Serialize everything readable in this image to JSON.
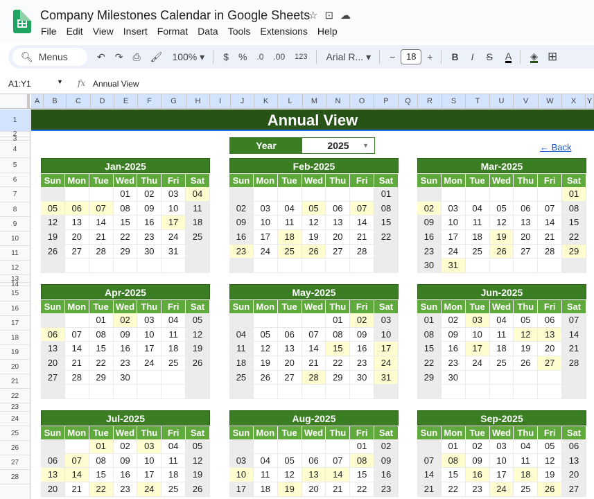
{
  "app": {
    "doc_title": "Company Milestones Calendar in Google Sheets",
    "menus": [
      "File",
      "Edit",
      "View",
      "Insert",
      "Format",
      "Data",
      "Tools",
      "Extensions",
      "Help"
    ]
  },
  "toolbar": {
    "search_label": "Menus",
    "zoom": "100%",
    "currency": "$",
    "percent": "%",
    "dec_decrease": ".0",
    "dec_increase": ".00",
    "number_format": "123",
    "font": "Arial R...",
    "font_size": "18",
    "bold": "B",
    "italic": "I",
    "strike": "S",
    "text_color": "A"
  },
  "formula_bar": {
    "cell_ref": "A1:Y1",
    "content": "Annual View"
  },
  "columns": [
    "A",
    "B",
    "C",
    "D",
    "E",
    "F",
    "G",
    "H",
    "I",
    "J",
    "K",
    "L",
    "M",
    "N",
    "O",
    "P",
    "Q",
    "R",
    "S",
    "T",
    "U",
    "V",
    "W",
    "X",
    "Y"
  ],
  "rows": [
    "1",
    "2",
    "3",
    "4",
    "5",
    "6",
    "7",
    "8",
    "9",
    "10",
    "11",
    "12",
    "13",
    "14",
    "15",
    "16",
    "17",
    "18",
    "19",
    "20",
    "21",
    "22",
    "23",
    "24",
    "25",
    "26",
    "27",
    "28"
  ],
  "sheet": {
    "banner": "Annual View",
    "year_label": "Year",
    "year_value": "2025",
    "back_link": "← Back",
    "day_names": [
      "Sun",
      "Mon",
      "Tue",
      "Wed",
      "Thu",
      "Fri",
      "Sat"
    ]
  },
  "months": [
    {
      "title": "Jan-2025",
      "weeks": [
        [
          "",
          "",
          "",
          "01",
          "02",
          "03",
          "04"
        ],
        [
          "05",
          "06",
          "07",
          "08",
          "09",
          "10",
          "11"
        ],
        [
          "12",
          "13",
          "14",
          "15",
          "16",
          "17",
          "18"
        ],
        [
          "19",
          "20",
          "21",
          "22",
          "23",
          "24",
          "25"
        ],
        [
          "26",
          "27",
          "28",
          "29",
          "30",
          "31",
          ""
        ],
        [
          "",
          "",
          "",
          "",
          "",
          "",
          ""
        ]
      ],
      "highlights": [
        "04",
        "05",
        "06",
        "07",
        "17"
      ]
    },
    {
      "title": "Feb-2025",
      "weeks": [
        [
          "",
          "",
          "",
          "",
          "",
          "",
          "01"
        ],
        [
          "02",
          "03",
          "04",
          "05",
          "06",
          "07",
          "08"
        ],
        [
          "09",
          "10",
          "11",
          "12",
          "13",
          "14",
          "15"
        ],
        [
          "16",
          "17",
          "18",
          "19",
          "20",
          "21",
          "22"
        ],
        [
          "23",
          "24",
          "25",
          "26",
          "27",
          "28",
          ""
        ],
        [
          "",
          "",
          "",
          "",
          "",
          "",
          ""
        ]
      ],
      "highlights": [
        "05",
        "07",
        "18",
        "23",
        "25",
        "26"
      ]
    },
    {
      "title": "Mar-2025",
      "weeks": [
        [
          "",
          "",
          "",
          "",
          "",
          "",
          "01"
        ],
        [
          "02",
          "03",
          "04",
          "05",
          "06",
          "07",
          "08"
        ],
        [
          "09",
          "10",
          "11",
          "12",
          "13",
          "14",
          "15"
        ],
        [
          "16",
          "17",
          "18",
          "19",
          "20",
          "21",
          "22"
        ],
        [
          "23",
          "24",
          "25",
          "26",
          "27",
          "28",
          "29"
        ],
        [
          "30",
          "31",
          "",
          "",
          "",
          "",
          ""
        ]
      ],
      "highlights": [
        "01",
        "02",
        "19",
        "26",
        "29",
        "31"
      ]
    },
    {
      "title": "Apr-2025",
      "weeks": [
        [
          "",
          "",
          "01",
          "02",
          "03",
          "04",
          "05"
        ],
        [
          "06",
          "07",
          "08",
          "09",
          "10",
          "11",
          "12"
        ],
        [
          "13",
          "14",
          "15",
          "16",
          "17",
          "18",
          "19"
        ],
        [
          "20",
          "21",
          "22",
          "23",
          "24",
          "25",
          "26"
        ],
        [
          "27",
          "28",
          "29",
          "30",
          "",
          "",
          ""
        ],
        [
          "",
          "",
          "",
          "",
          "",
          "",
          ""
        ]
      ],
      "highlights": [
        "02",
        "06"
      ]
    },
    {
      "title": "May-2025",
      "weeks": [
        [
          "",
          "",
          "",
          "",
          "01",
          "02",
          "03"
        ],
        [
          "04",
          "05",
          "06",
          "07",
          "08",
          "09",
          "10"
        ],
        [
          "11",
          "12",
          "13",
          "14",
          "15",
          "16",
          "17"
        ],
        [
          "18",
          "19",
          "20",
          "21",
          "22",
          "23",
          "24"
        ],
        [
          "25",
          "26",
          "27",
          "28",
          "29",
          "30",
          "31"
        ],
        [
          "",
          "",
          "",
          "",
          "",
          "",
          ""
        ]
      ],
      "highlights": [
        "02",
        "15",
        "17",
        "24",
        "28",
        "31"
      ]
    },
    {
      "title": "Jun-2025",
      "weeks": [
        [
          "01",
          "02",
          "03",
          "04",
          "05",
          "06",
          "07"
        ],
        [
          "08",
          "09",
          "10",
          "11",
          "12",
          "13",
          "14"
        ],
        [
          "15",
          "16",
          "17",
          "18",
          "19",
          "20",
          "21"
        ],
        [
          "22",
          "23",
          "24",
          "25",
          "26",
          "27",
          "28"
        ],
        [
          "29",
          "30",
          "",
          "",
          "",
          "",
          ""
        ],
        [
          "",
          "",
          "",
          "",
          "",
          "",
          ""
        ]
      ],
      "highlights": [
        "03",
        "12",
        "13",
        "17",
        "27"
      ]
    },
    {
      "title": "Jul-2025",
      "weeks": [
        [
          "",
          "",
          "01",
          "02",
          "03",
          "04",
          "05"
        ],
        [
          "06",
          "07",
          "08",
          "09",
          "10",
          "11",
          "12"
        ],
        [
          "13",
          "14",
          "15",
          "16",
          "17",
          "18",
          "19"
        ],
        [
          "20",
          "21",
          "22",
          "23",
          "24",
          "25",
          "26"
        ]
      ],
      "highlights": [
        "01",
        "03",
        "07",
        "13",
        "14",
        "22",
        "24"
      ]
    },
    {
      "title": "Aug-2025",
      "weeks": [
        [
          "",
          "",
          "",
          "",
          "",
          "01",
          "02"
        ],
        [
          "03",
          "04",
          "05",
          "06",
          "07",
          "08",
          "09"
        ],
        [
          "10",
          "11",
          "12",
          "13",
          "14",
          "15",
          "16"
        ],
        [
          "17",
          "18",
          "19",
          "20",
          "21",
          "22",
          "23"
        ]
      ],
      "highlights": [
        "08",
        "10",
        "13",
        "14",
        "19"
      ]
    },
    {
      "title": "Sep-2025",
      "weeks": [
        [
          "",
          "01",
          "02",
          "03",
          "04",
          "05",
          "06"
        ],
        [
          "07",
          "08",
          "09",
          "10",
          "11",
          "12",
          "13"
        ],
        [
          "14",
          "15",
          "16",
          "17",
          "18",
          "19",
          "20"
        ],
        [
          "21",
          "22",
          "23",
          "24",
          "25",
          "26",
          "27"
        ]
      ],
      "highlights": [
        "08",
        "16",
        "18",
        "24",
        "26"
      ]
    }
  ],
  "colors": {
    "banner": "#275317",
    "header": "#3a7d22",
    "dayname": "#60a93d",
    "highlight": "#fdfdcf",
    "weekend": "#ececec"
  }
}
